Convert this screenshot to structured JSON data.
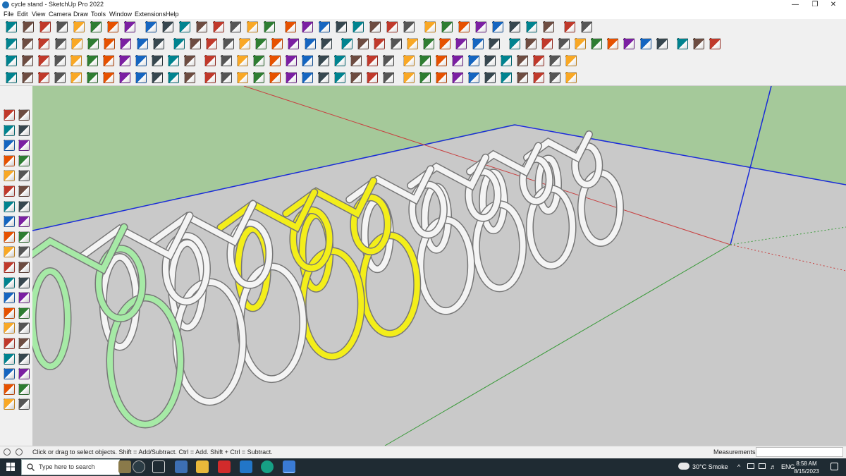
{
  "window": {
    "title": "cycle stand - SketchUp Pro 2022",
    "controls": {
      "minimize": "—",
      "restore": "❐",
      "close": "✕"
    }
  },
  "menu": [
    "File",
    "Edit",
    "View",
    "Camera",
    "Draw",
    "Tools",
    "Window",
    "Extensions",
    "Help"
  ],
  "toolbar": {
    "icon_set": [
      "select",
      "eraser",
      "line",
      "arc",
      "shape",
      "push-pull",
      "move",
      "rotate",
      "scale",
      "offset",
      "tape",
      "text",
      "orbit",
      "pan",
      "zoom",
      "section",
      "component",
      "solid-tools",
      "sandbox",
      "extension"
    ]
  },
  "left_toolbar": {
    "icons": [
      "select-icon",
      "orbit-icon",
      "paint-bucket-icon",
      "eraser-icon",
      "component-icon",
      "tag-icon",
      "line-icon",
      "freehand-icon",
      "rectangle-icon",
      "rotated-rect-icon",
      "circle-icon",
      "polygon-icon",
      "arc-icon",
      "pie-icon",
      "2pt-arc-icon",
      "3pt-arc-icon",
      "move-icon",
      "push-pull-icon",
      "rotate-icon",
      "follow-me-icon",
      "scale-icon",
      "offset-icon",
      "tape-icon",
      "text-icon",
      "protractor-icon",
      "axes-icon",
      "dimension-icon",
      "3d-text-icon",
      "orbit2-icon",
      "pan-icon",
      "zoom-icon",
      "zoom-window-icon",
      "zoom-extents-icon",
      "walk-icon",
      "look-around-icon",
      "position-camera-icon",
      "footprints-icon",
      "section-plane-icon",
      "sandbox-icon",
      "smoove-icon"
    ]
  },
  "viewport": {
    "sky_color": "#a5c99a",
    "ground_color": "#c9c9c9",
    "axis_colors": {
      "blue": "#1a2bd8",
      "red": "#c84040",
      "green": "#3a9a3a"
    },
    "model_colors": {
      "white": "#f4f4f4",
      "yellow": "#f3ee1a",
      "green": "#a6eaa6"
    }
  },
  "status": {
    "message": "Click or drag to select objects. Shift = Add/Subtract. Ctrl = Add. Shift + Ctrl = Subtract.",
    "measurements_label": "Measurements",
    "measurements_value": ""
  },
  "taskbar": {
    "search_placeholder": "Type here to search",
    "weather": "30°C  Smoke",
    "language": "ENG",
    "time": "8:58 AM",
    "date": "8/15/2023"
  }
}
